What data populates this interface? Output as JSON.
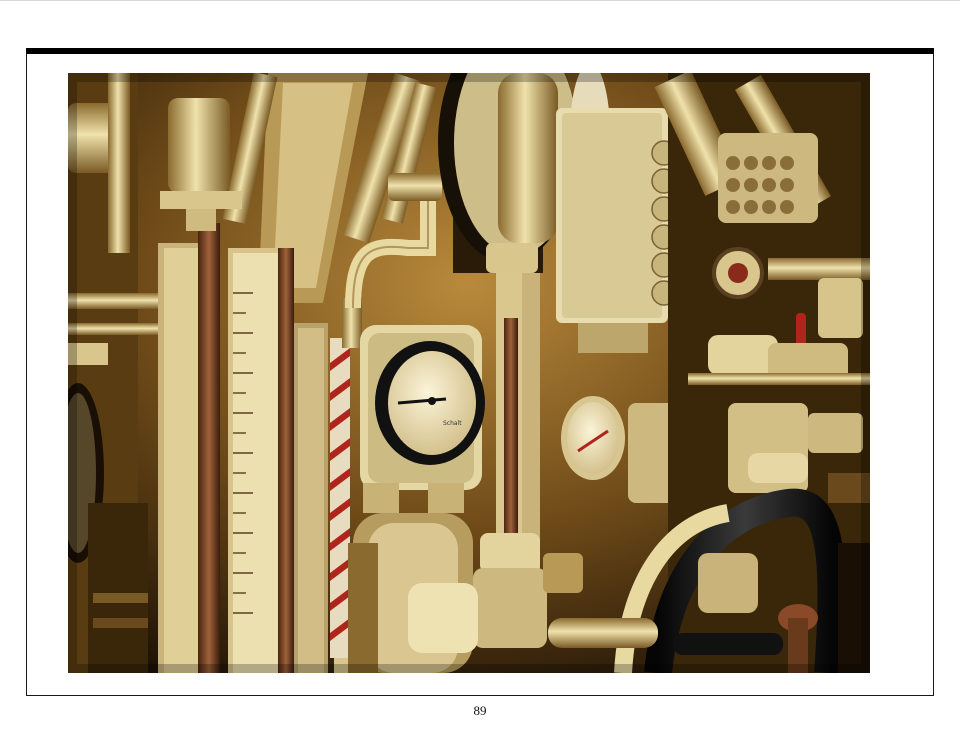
{
  "page": {
    "number": "89"
  },
  "photo": {
    "subject": "submarine-machinery-photo",
    "gauge_text": "Schalt"
  },
  "colors": {
    "frame": "#000000",
    "paint": "#e8d9a0",
    "shadow": "#2a1a08",
    "accent_red": "#b0251b",
    "accent_blue": "#3b4cff"
  }
}
